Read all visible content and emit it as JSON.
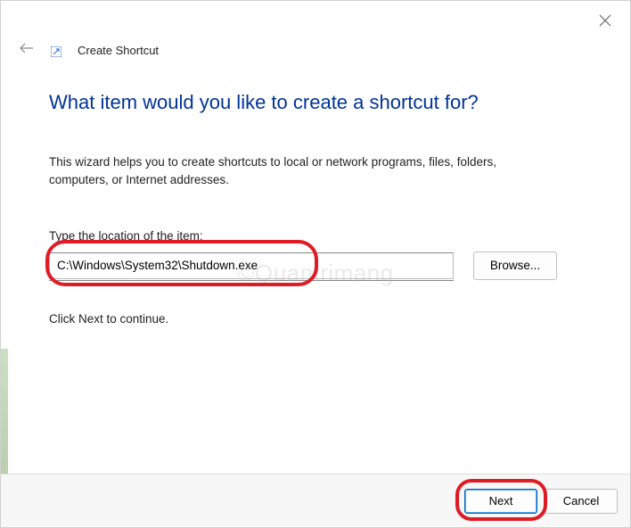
{
  "window": {
    "title": "Create Shortcut",
    "heading": "What item would you like to create a shortcut for?",
    "description": "This wizard helps you to create shortcuts to local or network programs, files, folders, computers, or Internet addresses.",
    "location_label": "Type the location of the item:",
    "location_value": "C:\\Windows\\System32\\Shutdown.exe",
    "browse_label": "Browse...",
    "continue_text": "Click Next to continue.",
    "next_label": "Next",
    "cancel_label": "Cancel"
  },
  "watermark": "©Quantrimang"
}
